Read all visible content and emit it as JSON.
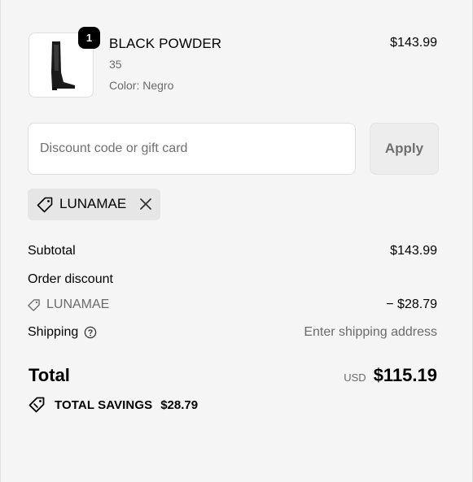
{
  "product": {
    "quantity": "1",
    "name": "BLACK POWDER",
    "size": "35",
    "color": "Color: Negro",
    "price": "$143.99",
    "image_icon": "boot-image"
  },
  "discount": {
    "placeholder": "Discount code or gift card",
    "apply_label": "Apply",
    "applied_code": "LUNAMAE"
  },
  "summary": {
    "subtotal_label": "Subtotal",
    "subtotal_value": "$143.99",
    "order_discount_label": "Order discount",
    "discount_code": "LUNAMAE",
    "discount_value": "− $28.79",
    "shipping_label": "Shipping",
    "shipping_value": "Enter shipping address",
    "total_label": "Total",
    "currency": "USD",
    "total_value": "$115.19",
    "savings_label": "TOTAL SAVINGS",
    "savings_value": "$28.79"
  },
  "colors": {
    "background": "#f5f5f5",
    "muted_text": "#6b6b6b",
    "chip_background": "#e6e6e6"
  }
}
